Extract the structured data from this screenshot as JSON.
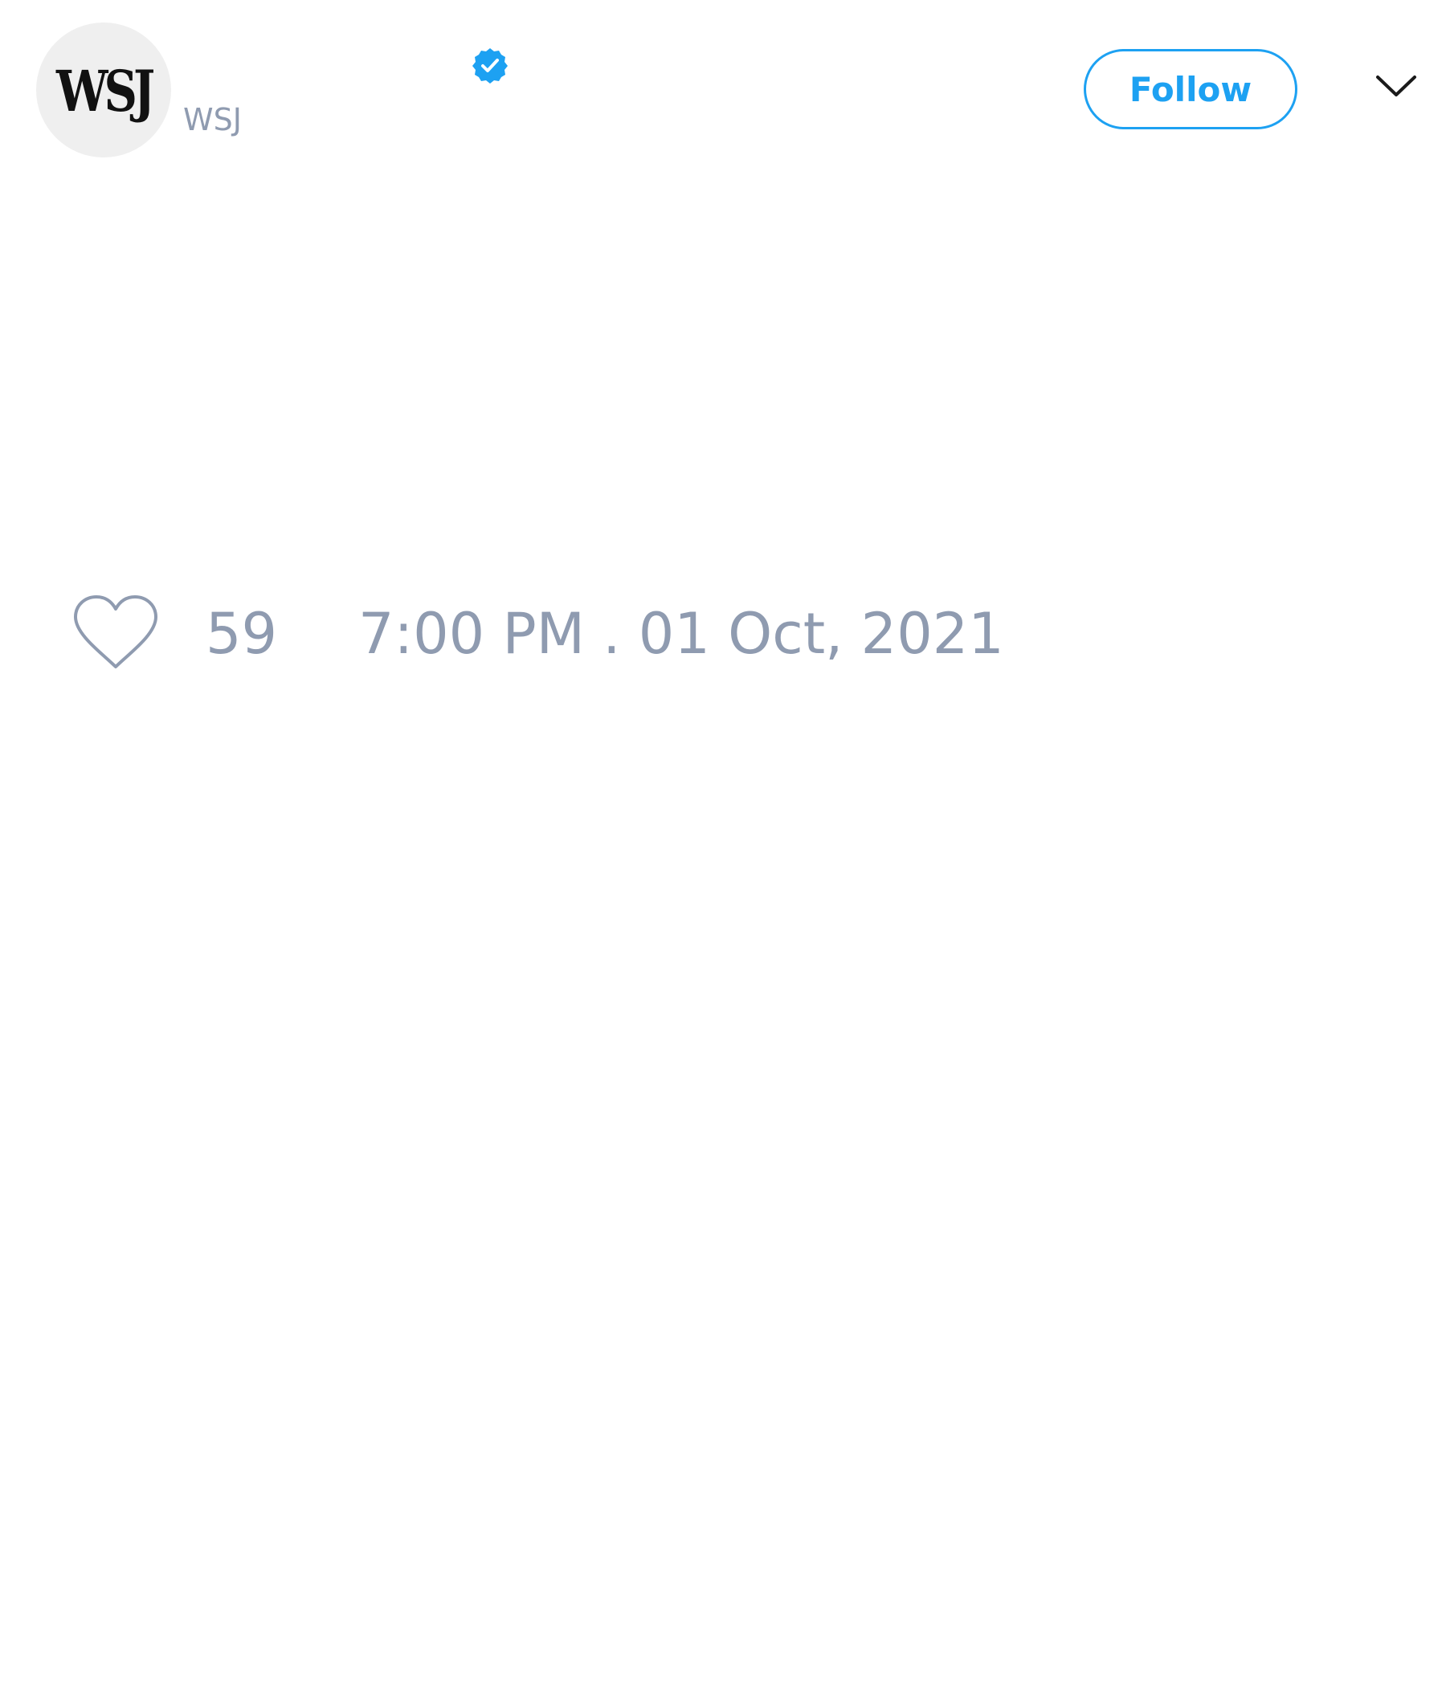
{
  "author": {
    "avatar_text": "WSJ",
    "handle": "WSJ",
    "verified": true
  },
  "actions": {
    "follow_label": "Follow"
  },
  "stats": {
    "likes": "59",
    "timestamp": "7:00 PM . 01 Oct, 2021"
  },
  "colors": {
    "accent": "#1da1f2",
    "muted_text": "#8f9bb0",
    "avatar_bg": "#efefef"
  },
  "icons": {
    "verified": "verified-badge-icon",
    "menu": "chevron-down-icon",
    "like": "heart-icon"
  }
}
